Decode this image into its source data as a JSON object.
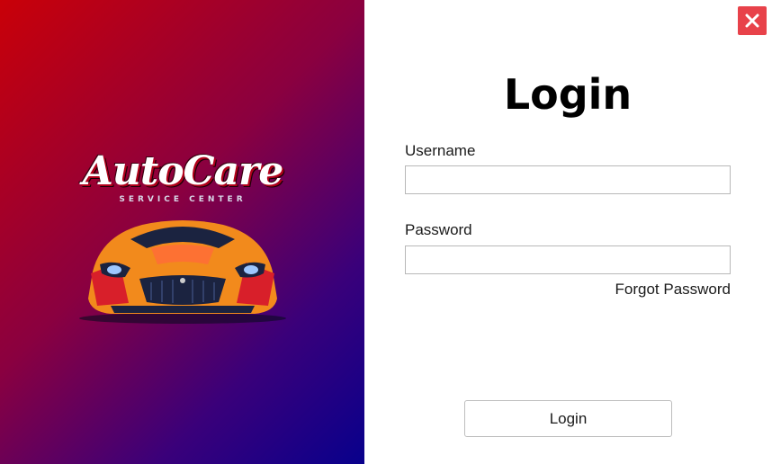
{
  "brand": {
    "logo_text": "AutoCare",
    "logo_subtitle": "SERVICE CENTER",
    "gradient_colors": [
      "#c90008",
      "#8a0040",
      "#3a007a",
      "#08008c"
    ]
  },
  "window": {
    "close_icon": "close-icon",
    "close_color": "#e8424a"
  },
  "form": {
    "title": "Login",
    "username_label": "Username",
    "username_value": "",
    "password_label": "Password",
    "password_value": "",
    "forgot_label": "Forgot Password",
    "submit_label": "Login"
  }
}
